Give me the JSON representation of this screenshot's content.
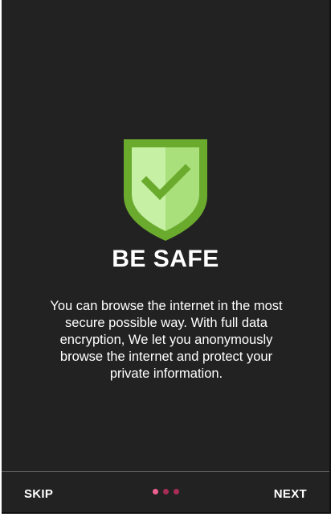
{
  "onboarding": {
    "title": "BE SAFE",
    "description": "You can browse the internet in the most secure possible way. With full data encryption, We let you anonymously browse the internet and protect your private information.",
    "illustration_icon": "shield-check-icon"
  },
  "pager": {
    "total_pages": 3,
    "current_page": 1,
    "dot_color": "#e2306c"
  },
  "footer": {
    "skip_label": "SKIP",
    "next_label": "NEXT"
  },
  "colors": {
    "background": "#232223",
    "shield_outer": "#6aab2e",
    "shield_inner_light": "#c6f0a3",
    "shield_inner_mid": "#a9e07c",
    "checkmark": "#6aab2e"
  }
}
